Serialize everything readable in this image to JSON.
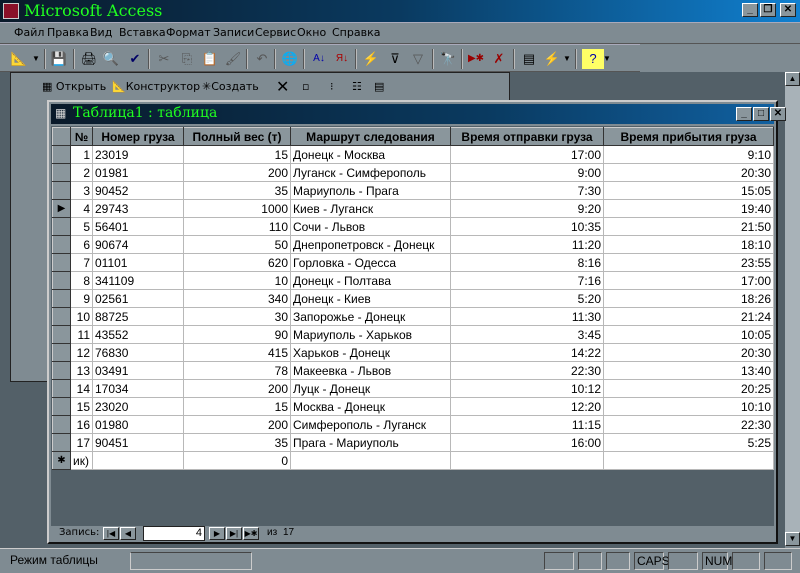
{
  "app": {
    "title": "Microsoft Access"
  },
  "menu": [
    "Файл",
    "Правка",
    "Вид",
    "Вставка",
    "Формат",
    "Записи",
    "Сервис",
    "Окно",
    "Справка"
  ],
  "db_toolbar": {
    "open": "Открыть",
    "design": "Конструктор",
    "create": "Создать"
  },
  "datasheet": {
    "title": "Таблица1 : таблица",
    "columns": [
      "№",
      "Номер груза",
      "Полный вес (т)",
      "Маршрут следования",
      "Время отправки груза",
      "Время прибытия груза"
    ],
    "rows": [
      [
        "1",
        "23019",
        "15",
        "Донецк - Москва",
        "17:00",
        "9:10"
      ],
      [
        "2",
        "01981",
        "200",
        "Луганск - Симферополь",
        "9:00",
        "20:30"
      ],
      [
        "3",
        "90452",
        "35",
        "Мариуполь - Прага",
        "7:30",
        "15:05"
      ],
      [
        "4",
        "29743",
        "1000",
        "Киев - Луганск",
        "9:20",
        "19:40"
      ],
      [
        "5",
        "56401",
        "110",
        "Сочи - Львов",
        "10:35",
        "21:50"
      ],
      [
        "6",
        "90674",
        "50",
        "Днепропетровск - Донецк",
        "11:20",
        "18:10"
      ],
      [
        "7",
        "01101",
        "620",
        "Горловка - Одесса",
        "8:16",
        "23:55"
      ],
      [
        "8",
        "341109",
        "10",
        "Донецк - Полтава",
        "7:16",
        "17:00"
      ],
      [
        "9",
        "02561",
        "340",
        "Донецк - Киев",
        "5:20",
        "18:26"
      ],
      [
        "10",
        "88725",
        "30",
        "Запорожье - Донецк",
        "11:30",
        "21:24"
      ],
      [
        "11",
        "43552",
        "90",
        "Мариуполь - Харьков",
        "3:45",
        "10:05"
      ],
      [
        "12",
        "76830",
        "415",
        "Харьков - Донецк",
        "14:22",
        "20:30"
      ],
      [
        "13",
        "03491",
        "78",
        "Макеевка - Львов",
        "22:30",
        "13:40"
      ],
      [
        "14",
        "17034",
        "200",
        "Луцк - Донецк",
        "10:12",
        "20:25"
      ],
      [
        "15",
        "23020",
        "15",
        "Москва - Донецк",
        "12:20",
        "10:10"
      ],
      [
        "16",
        "01980",
        "200",
        "Симферополь - Луганск",
        "11:15",
        "22:30"
      ],
      [
        "17",
        "90451",
        "35",
        "Прага - Мариуполь",
        "16:00",
        "5:25"
      ]
    ],
    "new_row": [
      "ик)",
      "",
      "0",
      "",
      "",
      ""
    ],
    "current_row": 4
  },
  "navigation": {
    "label": "Запись:",
    "current": "4",
    "of": "из",
    "total": "17"
  },
  "status": {
    "mode": "Режим таблицы",
    "caps": "CAPS",
    "num": "NUM"
  }
}
